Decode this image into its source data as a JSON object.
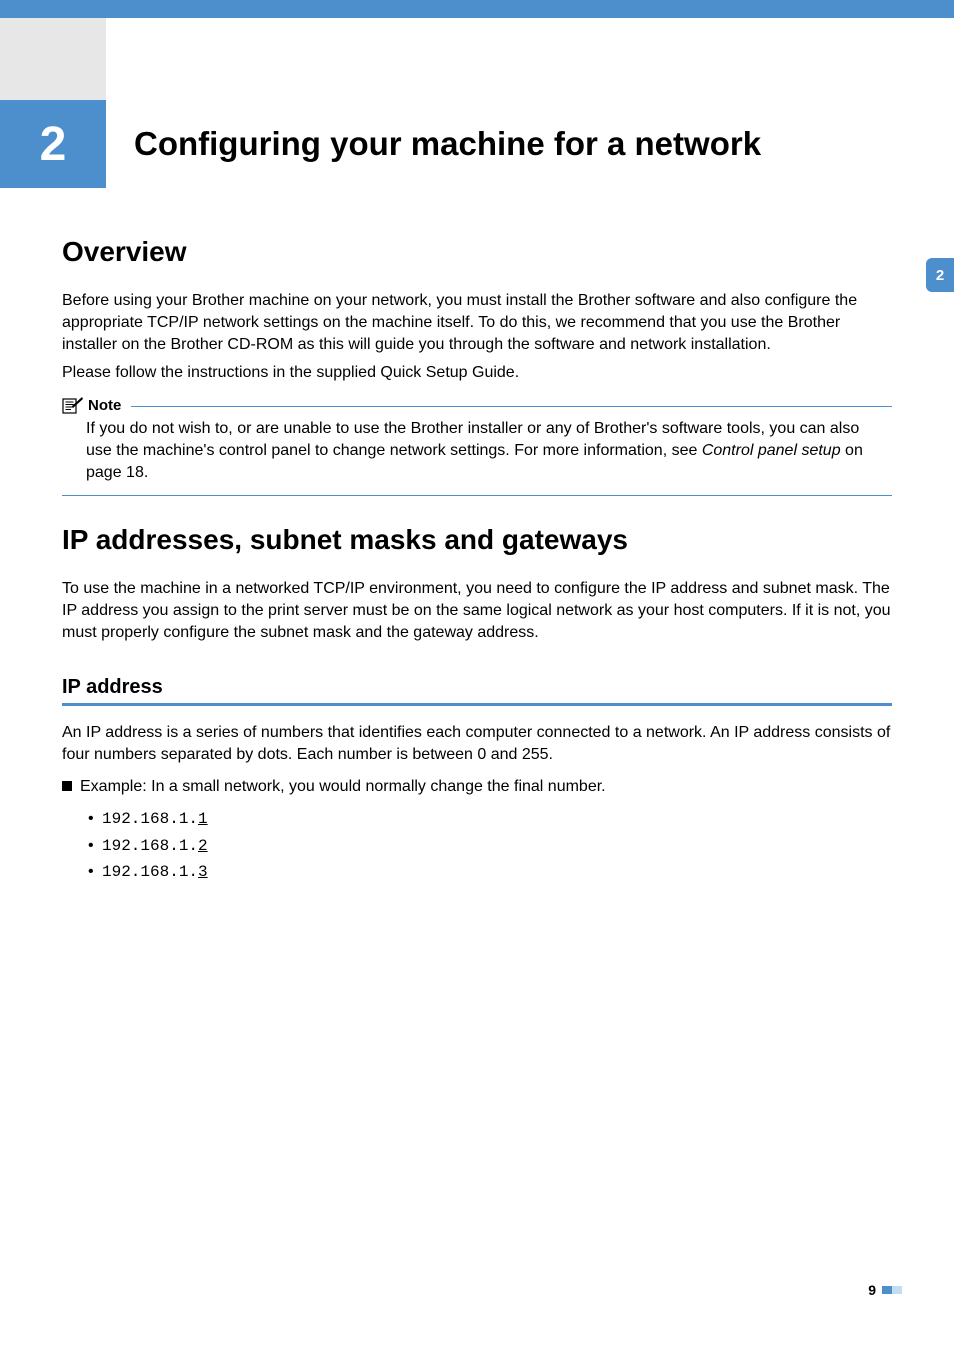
{
  "chapter": {
    "number": "2",
    "title": "Configuring your machine for a network"
  },
  "side_tab": "2",
  "overview": {
    "heading": "Overview",
    "para1": "Before using your Brother machine on your network, you must install the Brother software and also configure the appropriate TCP/IP network settings on the machine itself. To do this, we recommend that you use the Brother installer on the Brother CD-ROM as this will guide you through the software and network installation.",
    "para2": "Please follow the instructions in the supplied Quick Setup Guide."
  },
  "note": {
    "label": "Note",
    "text_part1": "If you do not wish to, or are unable to use the Brother installer or any of Brother's software tools, you can also use the machine's control panel to change network settings. For more information, see ",
    "text_italic": "Control panel setup",
    "text_part2": " on page 18."
  },
  "ip_section": {
    "heading": "IP addresses, subnet masks and gateways",
    "para": "To use the machine in a networked TCP/IP environment, you need to configure the IP address and subnet mask. The IP address you assign to the print server must be on the same logical network as your host computers. If it is not, you must properly configure the subnet mask and the gateway address."
  },
  "ip_address": {
    "heading": "IP address",
    "para": "An IP address is a series of numbers that identifies each computer connected to a network. An IP address consists of four numbers separated by dots. Each number is between 0 and 255.",
    "example_label": "Example: In a small network, you would normally change the final number.",
    "ips": [
      {
        "prefix": "192.168.1.",
        "last": "1"
      },
      {
        "prefix": "192.168.1.",
        "last": "2"
      },
      {
        "prefix": "192.168.1.",
        "last": "3"
      }
    ]
  },
  "page_number": "9"
}
